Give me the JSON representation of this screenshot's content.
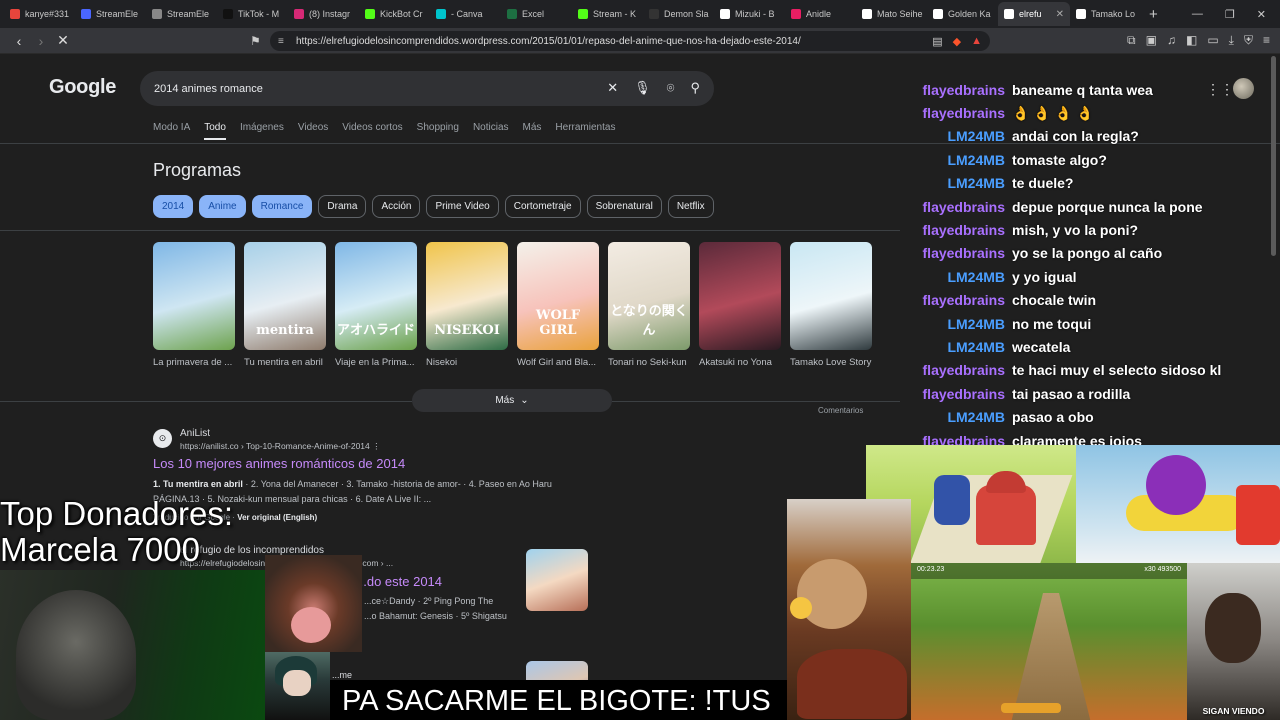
{
  "browser": {
    "tabs": [
      {
        "label": "kanye#331",
        "color": "#e8453c"
      },
      {
        "label": "StreamEle",
        "color": "#4a66ff"
      },
      {
        "label": "StreamEle",
        "color": "#888888"
      },
      {
        "label": "TikTok - M",
        "color": "#111111"
      },
      {
        "label": "(8) Instagr",
        "color": "#d62976"
      },
      {
        "label": "KickBot Cr",
        "color": "#53fc18"
      },
      {
        "label": "- Canva",
        "color": "#00c4cc"
      },
      {
        "label": "Excel",
        "color": "#1d6f42"
      },
      {
        "label": "Stream - K",
        "color": "#53fc18"
      },
      {
        "label": "Demon Sla",
        "color": "#333333"
      },
      {
        "label": "Mizuki - B",
        "color": "#ffffff"
      },
      {
        "label": "Anidle",
        "color": "#e91e63"
      },
      {
        "label": "Mato Seihe",
        "color": "#ffffff"
      },
      {
        "label": "Golden Ka",
        "color": "#ffffff"
      },
      {
        "label": "elrefu",
        "color": "#ffffff",
        "active": true
      },
      {
        "label": "Tamako Lo",
        "color": "#ffffff"
      }
    ],
    "url": "https://elrefugiodelosincomprendidos.wordpress.com/2015/01/01/repaso-del-anime-que-nos-ha-dejado-este-2014/"
  },
  "google": {
    "logo": "Google",
    "query": "2014 animes romance",
    "tabs": [
      "Modo IA",
      "Todo",
      "Imágenes",
      "Videos",
      "Videos cortos",
      "Shopping",
      "Noticias",
      "Más",
      "Herramientas"
    ],
    "active_tab": "Todo",
    "section_title": "Programas",
    "chips": [
      {
        "label": "2014",
        "selected": true
      },
      {
        "label": "Anime",
        "selected": true
      },
      {
        "label": "Romance",
        "selected": true
      },
      {
        "label": "Drama",
        "selected": false
      },
      {
        "label": "Acción",
        "selected": false
      },
      {
        "label": "Prime Video",
        "selected": false
      },
      {
        "label": "Cortometraje",
        "selected": false
      },
      {
        "label": "Sobrenatural",
        "selected": false
      },
      {
        "label": "Netflix",
        "selected": false
      }
    ],
    "cards": [
      {
        "title": "La primavera de ...",
        "colors": [
          "#7fb7e6",
          "#cfe6f2",
          "#6da24d"
        ],
        "poster_text": ""
      },
      {
        "title": "Tu mentira en abril",
        "colors": [
          "#a7d0e8",
          "#e7eef3",
          "#8d7a6b"
        ],
        "poster_text": "mentira"
      },
      {
        "title": "Viaje en la Prima...",
        "colors": [
          "#7fb7e6",
          "#d6ecf5",
          "#6aa04a"
        ],
        "poster_text": "アオハライド"
      },
      {
        "title": "Nisekoi",
        "colors": [
          "#f0c44a",
          "#f7e9cf",
          "#2d6b44"
        ],
        "poster_text": "NISEKOI"
      },
      {
        "title": "Wolf Girl and Bla...",
        "colors": [
          "#f4f1ea",
          "#f7c3bb",
          "#e9a23b"
        ],
        "poster_text": "WOLF GIRL"
      },
      {
        "title": "Tonari no Seki-kun",
        "colors": [
          "#f3ece3",
          "#e0d8c8",
          "#7c9a6a"
        ],
        "poster_text": "となりの関くん"
      },
      {
        "title": "Akatsuki no Yona",
        "colors": [
          "#5b2a3a",
          "#b24a5a",
          "#2a1a22"
        ],
        "poster_text": ""
      },
      {
        "title": "Tamako Love Story",
        "colors": [
          "#c9e7f3",
          "#eef6f9",
          "#2f3a3e"
        ],
        "poster_text": ""
      }
    ],
    "more_label": "Más",
    "comments_label": "Comentarios",
    "results": [
      {
        "site": "AniList",
        "cite": "https://anilist.co › Top-10-Romance-Anime-of-2014",
        "title": "Los 10 mejores animes románticos de 2014",
        "snippet_bold": "1. Tu mentira en abril",
        "snippet": " · 2. Yona del Amanecer · 3. Tamako -historia de amor- · 4. Paseo en Ao Haru PÁGINA.13 · 5. Nozaki-kun mensual para chicas · 6. Date A Live II: ...",
        "translated_prefix": "Traducido por Google · ",
        "translated_link": "Ver original (English)"
      },
      {
        "site": "el refugio de los incomprendidos",
        "cite": "https://elrefugiodelosincomprendidos.wordpress.com › ...",
        "title": "...do este 2014",
        "snippet_line1": "...ce☆Dandy · 2º Ping Pong The",
        "snippet_line2": "...o Bahamut: Genesis · 5º Shigatsu"
      },
      {
        "site": "...me"
      }
    ]
  },
  "chat": {
    "user_colors": {
      "flayedbrains": "#a970ff",
      "LM24MB": "#4a9eff"
    },
    "messages": [
      {
        "user": "flayedbrains",
        "text": "baneame q tanta wea"
      },
      {
        "user": "flayedbrains",
        "text": "👌 👌 👌 👌"
      },
      {
        "user": "LM24MB",
        "text": "andai con la regla?"
      },
      {
        "user": "LM24MB",
        "text": "tomaste algo?"
      },
      {
        "user": "LM24MB",
        "text": "te duele?"
      },
      {
        "user": "flayedbrains",
        "text": "depue porque nunca la pone"
      },
      {
        "user": "flayedbrains",
        "text": "mish, y vo la poni?"
      },
      {
        "user": "flayedbrains",
        "text": "yo se la pongo al caño"
      },
      {
        "user": "LM24MB",
        "text": "y yo igual"
      },
      {
        "user": "flayedbrains",
        "text": "chocale twin"
      },
      {
        "user": "LM24MB",
        "text": "no me toqui"
      },
      {
        "user": "LM24MB",
        "text": "wecatela"
      },
      {
        "user": "flayedbrains",
        "text": "te haci muy el selecto sidoso kl"
      },
      {
        "user": "flayedbrains",
        "text": "tai pasao a rodilla"
      },
      {
        "user": "LM24MB",
        "text": "pasao a obo"
      },
      {
        "user": "flayedbrains",
        "text": "claramente es jojos"
      }
    ]
  },
  "overlay": {
    "donors_title": "Top Donadores:",
    "donors_line": "Marcela 7000",
    "subtitle": "PA SACARME EL BIGOTE: !TUS",
    "sigan_label": "SIGAN VIENDO",
    "subway_hud_left": "00:23.23",
    "subway_hud_right": "x30  493500"
  }
}
